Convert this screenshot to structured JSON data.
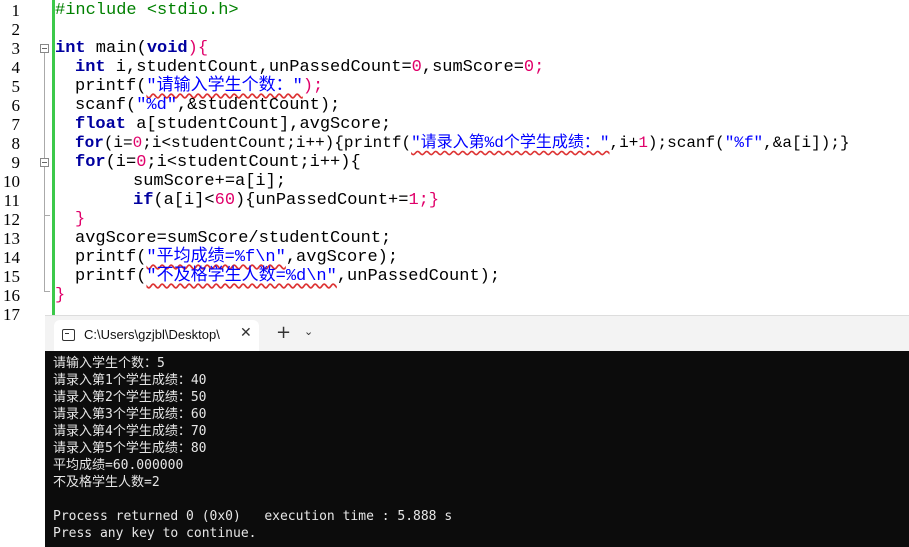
{
  "editor": {
    "line_numbers": [
      "1",
      "2",
      "3",
      "4",
      "5",
      "6",
      "7",
      "8",
      "9",
      "10",
      "11",
      "12",
      "13",
      "14",
      "15",
      "16",
      "17"
    ],
    "code": {
      "l1": "#include <stdio.h>",
      "l3_kw": "int",
      "l3_rest": " main(",
      "l3_kw2": "void",
      "l3_end": "){",
      "l4_kw": "int",
      "l4_rest": " i,studentCount,unPassedCount=",
      "l4_n1": "0",
      "l4_mid": ",sumScore=",
      "l4_n2": "0",
      "l4_end": ";",
      "l5_a": "printf(",
      "l5_str": "\"请输入学生个数：\"",
      "l5_b": ");",
      "l6_a": "scanf(",
      "l6_str": "\"%d\"",
      "l6_b": ",&studentCount);",
      "l7_kw": "float",
      "l7_rest": " a[studentCount],avgScore;",
      "l8_kw": "for",
      "l8_a": "(i=",
      "l8_n": "0",
      "l8_b": ";i<studentCount;i++){printf(",
      "l8_str": "\"请录入第%d个学生成绩：\"",
      "l8_c": ",i+",
      "l8_n2": "1",
      "l8_d": ");scanf(",
      "l8_str2": "\"%f\"",
      "l8_e": ",&a[i]);}",
      "l9_kw": "for",
      "l9_a": "(i=",
      "l9_n": "0",
      "l9_b": ";i<studentCount;i++){",
      "l10": "sumScore+=a[i];",
      "l11_kw": "if",
      "l11_a": "(a[i]<",
      "l11_n": "60",
      "l11_b": "){unPassedCount+=",
      "l11_n2": "1",
      "l11_c": ";}",
      "l12": "}",
      "l13": "avgScore=sumScore/studentCount;",
      "l14_a": "printf(",
      "l14_str": "\"平均成绩=%f\\n\"",
      "l14_b": ",avgScore);",
      "l15_a": "printf(",
      "l15_str": "\"不及格学生人数=%d\\n\"",
      "l15_b": ",unPassedCount);",
      "l16": "}"
    }
  },
  "console": {
    "tab_title": "C:\\Users\\gzjbl\\Desktop\\",
    "tab_icon": "terminal-icon",
    "close_glyph": "✕",
    "new_tab_glyph": "+",
    "menu_glyph": "⌄",
    "output": [
      "请输入学生个数：5",
      "请录入第1个学生成绩：40",
      "请录入第2个学生成绩：50",
      "请录入第3个学生成绩：60",
      "请录入第4个学生成绩：70",
      "请录入第5个学生成绩：80",
      "平均成绩=60.000000",
      "不及格学生人数=2",
      "",
      "Process returned 0 (0x0)   execution time : 5.888 s",
      "Press any key to continue."
    ]
  },
  "colors": {
    "keyword": "#00009f",
    "preprocessor": "#008000",
    "string": "#0000ff",
    "number": "#e0006a",
    "fold_bar": "#3cc94a",
    "console_bg": "#0c0c0c"
  }
}
